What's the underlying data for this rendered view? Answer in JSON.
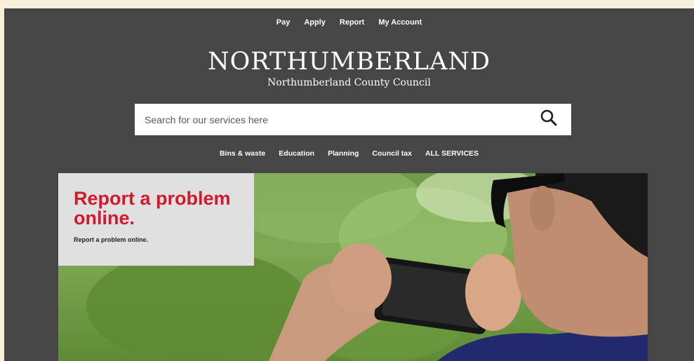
{
  "top_nav": {
    "items": [
      "Pay",
      "Apply",
      "Report",
      "My Account"
    ]
  },
  "logo": {
    "wordmark": "NORTHUMBERLAND",
    "subtitle": "Northumberland County Council"
  },
  "search": {
    "placeholder": "Search for our services here",
    "icon": "search-icon"
  },
  "main_nav": {
    "items": [
      "Bins & waste",
      "Education",
      "Planning",
      "Council tax",
      "ALL SERVICES"
    ]
  },
  "hero": {
    "heading": "Report a problem online.",
    "text": "Report a problem online.",
    "image": "person-photographing-with-phone"
  },
  "colors": {
    "frame_background": "#464646",
    "outer_background": "#f6efd9",
    "hero_heading": "#d3192c",
    "hero_card": "#e0e0e0",
    "foliage": "#6f9b44"
  }
}
